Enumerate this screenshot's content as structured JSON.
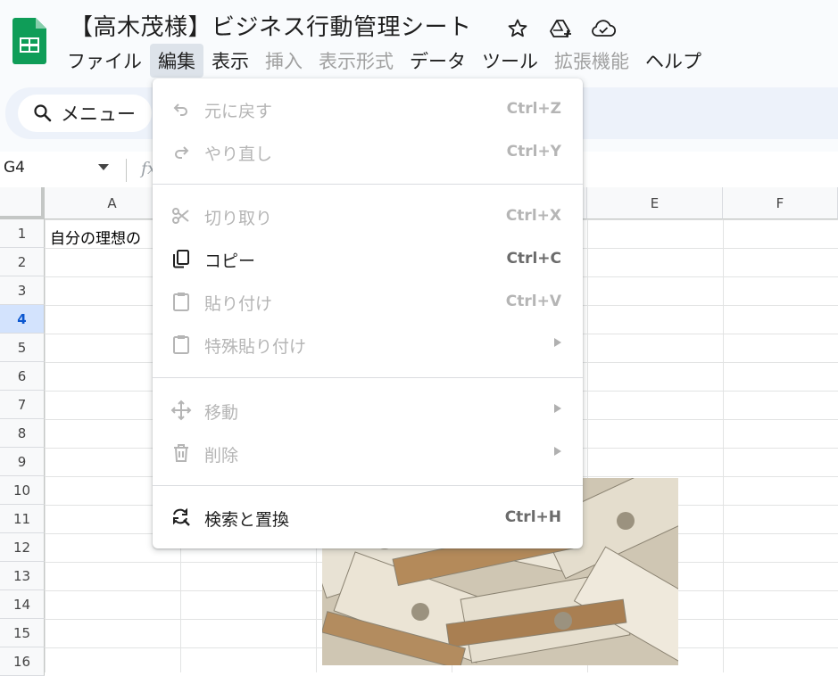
{
  "app": {
    "title": "【高木茂様】ビジネス行動管理シート",
    "icons": [
      "star-icon",
      "drive-move-icon",
      "cloud-saved-icon"
    ]
  },
  "menubar": [
    {
      "label": "ファイル",
      "state": "normal"
    },
    {
      "label": "編集",
      "state": "active"
    },
    {
      "label": "表示",
      "state": "normal"
    },
    {
      "label": "挿入",
      "state": "disabled"
    },
    {
      "label": "表示形式",
      "state": "disabled"
    },
    {
      "label": "データ",
      "state": "normal"
    },
    {
      "label": "ツール",
      "state": "normal"
    },
    {
      "label": "拡張機能",
      "state": "disabled"
    },
    {
      "label": "ヘルプ",
      "state": "normal"
    }
  ],
  "toolbar": {
    "menu_search_label": "メニュー"
  },
  "formula_bar": {
    "name_box": "G4",
    "fx": "fx"
  },
  "sheet": {
    "columns": [
      "A",
      "B",
      "C",
      "D",
      "E",
      "F"
    ],
    "rows": [
      "1",
      "2",
      "3",
      "4",
      "5",
      "6",
      "7",
      "8",
      "9",
      "10",
      "11",
      "12",
      "13",
      "14",
      "15",
      "16"
    ],
    "active_row": "4",
    "cell_a1": "自分の理想の"
  },
  "edit_menu": {
    "undo": {
      "label": "元に戻す",
      "shortcut": "Ctrl+Z"
    },
    "redo": {
      "label": "やり直し",
      "shortcut": "Ctrl+Y"
    },
    "cut": {
      "label": "切り取り",
      "shortcut": "Ctrl+X"
    },
    "copy": {
      "label": "コピー",
      "shortcut": "Ctrl+C"
    },
    "paste": {
      "label": "貼り付け",
      "shortcut": "Ctrl+V"
    },
    "paste_special": {
      "label": "特殊貼り付け"
    },
    "move": {
      "label": "移動"
    },
    "delete": {
      "label": "削除"
    },
    "find_replace": {
      "label": "検索と置換",
      "shortcut": "Ctrl+H"
    }
  },
  "colors": {
    "sheets_green": "#0f9d58",
    "active_row_bg": "#d3e3fd",
    "active_row_fg": "#0b57d0",
    "menu_active_bg": "#dde3ea"
  }
}
